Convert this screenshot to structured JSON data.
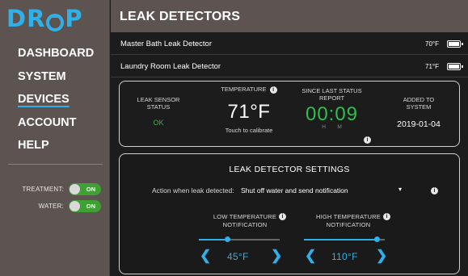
{
  "brand": {
    "logo_text": "DROP",
    "accent": "#2fb0e8",
    "green": "#3fa034"
  },
  "sidebar": {
    "nav": [
      {
        "label": "DASHBOARD",
        "active": false
      },
      {
        "label": "SYSTEM",
        "active": false
      },
      {
        "label": "DEVICES",
        "active": true
      },
      {
        "label": "ACCOUNT",
        "active": false
      },
      {
        "label": "HELP",
        "active": false
      }
    ],
    "toggles": [
      {
        "label": "TREATMENT:",
        "state": "ON"
      },
      {
        "label": "WATER:",
        "state": "ON"
      }
    ]
  },
  "header": {
    "title": "LEAK DETECTORS"
  },
  "devices": [
    {
      "name": "Master Bath Leak Detector",
      "temp": "70°F"
    },
    {
      "name": "Laundry Room Leak Detector",
      "temp": "71°F"
    }
  ],
  "status": {
    "sensor_label": "LEAK SENSOR STATUS",
    "sensor_value": "OK",
    "temperature_label": "TEMPERATURE",
    "temperature_value": "71°F",
    "calibrate_text": "Touch to calibrate",
    "since_label": "SINCE LAST STATUS REPORT",
    "since_value": "00:09",
    "since_h": "H",
    "since_m": "M",
    "added_label": "ADDED TO SYSTEM",
    "added_value": "2019-01-04"
  },
  "settings": {
    "title": "LEAK DETECTOR SETTINGS",
    "action_label": "Action when leak detected:",
    "action_value": "Shut off water and send notification",
    "low_label": "LOW TEMPERATURE NOTIFICATION",
    "low_value": "45°F",
    "low_level": 0.35,
    "high_label": "HIGH TEMPERATURE NOTIFICATION",
    "high_value": "110°F",
    "high_level": 0.9
  }
}
